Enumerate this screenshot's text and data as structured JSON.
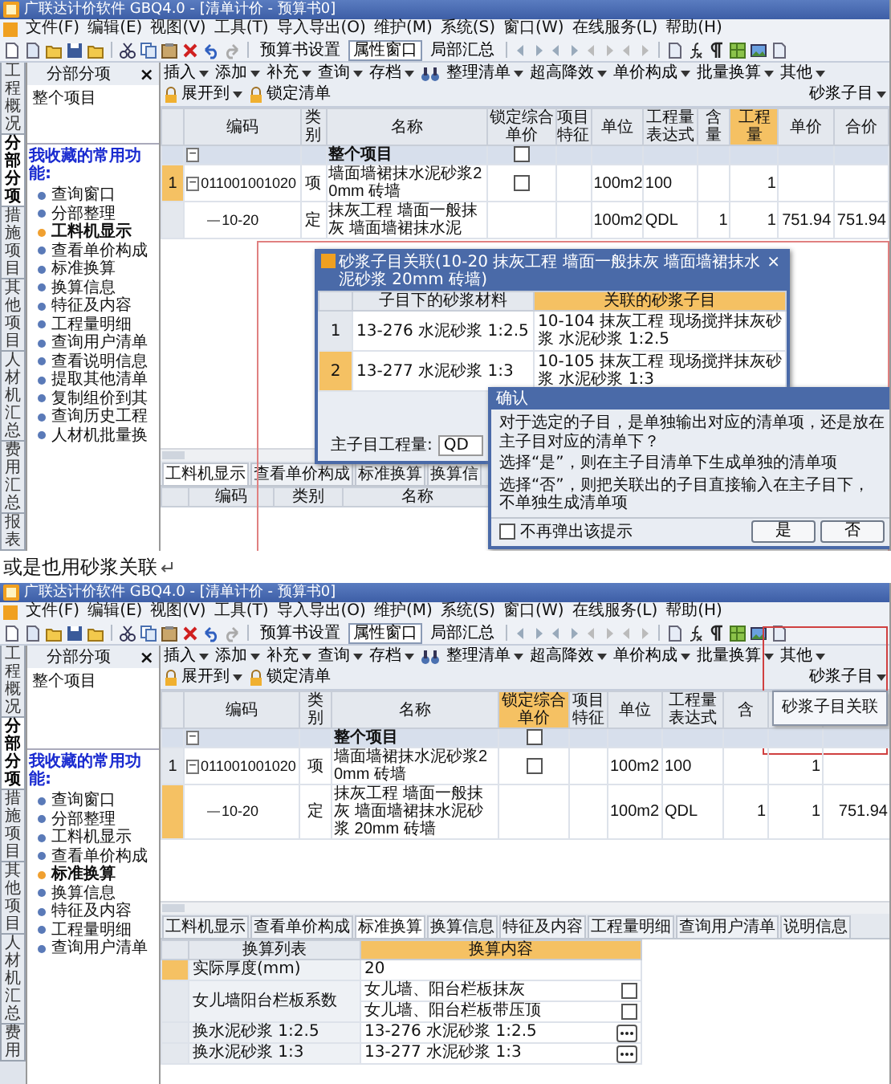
{
  "shot_1": {
    "window": {
      "title": "广联达计价软件 GBQ4.0 - [清单计价 - 预算书0]"
    },
    "menu": [
      "文件(F)",
      "编辑(E)",
      "视图(V)",
      "工具(T)",
      "导入导出(O)",
      "维护(M)",
      "系统(S)",
      "窗口(W)",
      "在线服务(L)",
      "帮助(H)"
    ],
    "toolbar": [
      {
        "label": "预算书设置",
        "pressed": false
      },
      {
        "label": "属性窗口",
        "pressed": true
      },
      {
        "label": "局部汇总",
        "pressed": false
      }
    ],
    "panel_title": "分部分项",
    "panel_close": "×",
    "toolbar2": [
      {
        "label": "插入",
        "dropdown": true
      },
      {
        "label": "添加",
        "dropdown": true
      },
      {
        "label": "补充",
        "dropdown": true
      },
      {
        "label": "查询",
        "dropdown": true
      },
      {
        "label": "存档",
        "dropdown": true
      },
      {
        "kind": "tool"
      },
      {
        "label": "整理清单",
        "dropdown": true
      },
      {
        "label": "超高降效",
        "dropdown": true
      },
      {
        "label": "单价构成",
        "dropdown": true
      },
      {
        "label": "批量换算",
        "dropdown": true
      },
      {
        "label": "其他",
        "dropdown": true
      },
      {
        "label": "展开到",
        "dropdown": true,
        "icon": true
      },
      {
        "label": "锁定清单",
        "dropdown": false,
        "icon": true
      },
      {
        "label": "砂浆子目",
        "dropdown": true
      }
    ],
    "side_tabs": [
      {
        "label": "工程概况",
        "selected": false
      },
      {
        "label": "分部分项",
        "selected": true
      },
      {
        "label": "措施项目",
        "selected": false
      },
      {
        "label": "其他项目",
        "selected": false
      },
      {
        "label": "人材机汇总",
        "selected": false
      },
      {
        "label": "费用汇总",
        "selected": false
      },
      {
        "label": "报表",
        "selected": false
      }
    ],
    "tree": [
      "整个项目"
    ],
    "favorites_title": "我收藏的常用功能:",
    "favorites": [
      {
        "label": "查询窗口",
        "selected": false
      },
      {
        "label": "分部整理",
        "selected": false
      },
      {
        "label": "工料机显示",
        "selected": true
      },
      {
        "label": "查看单价构成",
        "selected": false
      },
      {
        "label": "标准换算",
        "selected": false
      },
      {
        "label": "换算信息",
        "selected": false
      },
      {
        "label": "特征及内容",
        "selected": false
      },
      {
        "label": "工程量明细",
        "selected": false
      },
      {
        "label": "查询用户清单",
        "selected": false
      },
      {
        "label": "查看说明信息",
        "selected": false
      },
      {
        "label": "提取其他清单",
        "selected": false
      },
      {
        "label": "复制组价到其",
        "selected": false
      },
      {
        "label": "查询历史工程",
        "selected": false
      },
      {
        "label": "人材机批量换",
        "selected": false
      }
    ],
    "table": {
      "columns": [
        {
          "label": "编码",
          "selected": false
        },
        {
          "label": "类别",
          "selected": false
        },
        {
          "label": "名称",
          "selected": false
        },
        {
          "label": "锁定综合单价",
          "selected": false
        },
        {
          "label": "项目特征",
          "selected": false
        },
        {
          "label": "单位",
          "selected": false
        },
        {
          "label": "工程量表达式",
          "selected": false
        },
        {
          "label": "含量",
          "selected": false
        },
        {
          "label": "工程量",
          "selected": true
        },
        {
          "label": "单价",
          "selected": false
        },
        {
          "label": "合价",
          "selected": false
        }
      ],
      "rows": [
        {
          "kind": "group",
          "selected": false,
          "toggle": "−",
          "cells": [
            null,
            null,
            "整个项目",
            {
              "kind": "checkbox",
              "checked": false
            },
            null,
            null,
            null,
            null,
            null,
            null,
            null
          ],
          "children": [
            {
              "kind": "item",
              "selected": true,
              "num": "1",
              "toggle": "−",
              "cells": [
                "011001001020",
                "项",
                "墙面墙裙抹水泥砂浆20mm 砖墙",
                {
                  "kind": "checkbox",
                  "checked": false
                },
                null,
                "100m2",
                "100",
                null,
                "1",
                null,
                null
              ],
              "children": [
                {
                  "kind": "item",
                  "selected": false,
                  "cells": [
                    "10-20",
                    "定",
                    "抹灰工程 墙面一般抹灰 墙面墙裙抹水泥",
                    null,
                    null,
                    "100m2",
                    "QDL",
                    "1",
                    "1",
                    "751.94",
                    "751.94"
                  ]
                }
              ]
            }
          ]
        }
      ]
    },
    "bottom_tabs": [
      {
        "label": "工料机显示",
        "selected": true
      },
      {
        "label": "查看单价构成",
        "selected": false
      },
      {
        "label": "标准换算",
        "selected": false
      },
      {
        "label": "换算信",
        "selected": false
      }
    ],
    "bottom_table": {
      "columns": [
        {
          "label": "编码",
          "selected": false
        },
        {
          "label": "类别",
          "selected": false
        },
        {
          "label": "名称",
          "selected": false
        }
      ]
    },
    "dialog": {
      "title": "砂浆子目关联(10-20 抹灰工程 墙面一般抹灰 墙面墙裙抹水泥砂浆 20mm 砖墙)",
      "close": "×",
      "columns": [
        {
          "label": "子目下的砂浆材料",
          "selected": false
        },
        {
          "label": "关联的砂浆子目",
          "selected": true
        }
      ],
      "rows": [
        {
          "num": "1",
          "selected": false,
          "cells": [
            "13-276 水泥砂浆 1:2.5",
            "10-104 抹灰工程 现场搅拌抹灰砂浆 水泥砂浆 1:2.5"
          ]
        },
        {
          "num": "2",
          "selected": true,
          "cells": [
            "13-277 水泥砂浆 1:3",
            "10-105 抹灰工程 现场搅拌抹灰砂浆 水泥砂浆 1:3"
          ]
        }
      ],
      "footer_label": "主子目工程量:",
      "footer_value": "QD"
    },
    "confirm": {
      "title": "确认",
      "paragraphs": [
        "对于选定的子目，是单独输出对应的清单项，还是放在主子目对应的清单下？",
        "选择“是”，则在主子目清单下生成单独的清单项",
        "选择“否”，则把关联出的子目直接输入在主子目下，不单独生成清单项"
      ],
      "checkbox": {
        "label": "不再弹出该提示",
        "checked": false
      },
      "buttons": [
        "是",
        "否"
      ]
    }
  },
  "caption": "或是也用砂浆关联",
  "shot_2": {
    "window": {
      "title": "广联达计价软件 GBQ4.0 - [清单计价 - 预算书0]"
    },
    "menu": [
      "文件(F)",
      "编辑(E)",
      "视图(V)",
      "工具(T)",
      "导入导出(O)",
      "维护(M)",
      "系统(S)",
      "窗口(W)",
      "在线服务(L)",
      "帮助(H)"
    ],
    "toolbar": [
      {
        "label": "预算书设置",
        "pressed": false
      },
      {
        "label": "属性窗口",
        "pressed": true
      },
      {
        "label": "局部汇总",
        "pressed": false
      }
    ],
    "panel_title": "分部分项",
    "panel_close": "×",
    "toolbar2": [
      {
        "label": "插入",
        "dropdown": true
      },
      {
        "label": "添加",
        "dropdown": true
      },
      {
        "label": "补充",
        "dropdown": true
      },
      {
        "label": "查询",
        "dropdown": true
      },
      {
        "label": "存档",
        "dropdown": true
      },
      {
        "kind": "tool"
      },
      {
        "label": "整理清单",
        "dropdown": true
      },
      {
        "label": "超高降效",
        "dropdown": true
      },
      {
        "label": "单价构成",
        "dropdown": true
      },
      {
        "label": "批量换算",
        "dropdown": true
      },
      {
        "label": "其他",
        "dropdown": true
      },
      {
        "label": "展开到",
        "dropdown": true,
        "icon": true
      },
      {
        "label": "锁定清单",
        "dropdown": false,
        "icon": true
      },
      {
        "label": "砂浆子目",
        "dropdown": true
      }
    ],
    "side_tabs": [
      {
        "label": "工程概况",
        "selected": false
      },
      {
        "label": "分部分项",
        "selected": true
      },
      {
        "label": "措施项目",
        "selected": false
      },
      {
        "label": "其他项目",
        "selected": false
      },
      {
        "label": "人材机汇总",
        "selected": false
      },
      {
        "label": "费用",
        "selected": false
      }
    ],
    "tree": [
      "整个项目"
    ],
    "favorites_title": "我收藏的常用功能:",
    "favorites": [
      {
        "label": "查询窗口",
        "selected": false
      },
      {
        "label": "分部整理",
        "selected": false
      },
      {
        "label": "工料机显示",
        "selected": false
      },
      {
        "label": "查看单价构成",
        "selected": false
      },
      {
        "label": "标准换算",
        "selected": true
      },
      {
        "label": "换算信息",
        "selected": false
      },
      {
        "label": "特征及内容",
        "selected": false
      },
      {
        "label": "工程量明细",
        "selected": false
      },
      {
        "label": "查询用户清单",
        "selected": false
      }
    ],
    "table": {
      "columns": [
        {
          "label": "编码",
          "selected": false
        },
        {
          "label": "类别",
          "selected": false
        },
        {
          "label": "名称",
          "selected": false
        },
        {
          "label": "锁定综合单价",
          "selected": true
        },
        {
          "label": "项目特征",
          "selected": false
        },
        {
          "label": "单位",
          "selected": false
        },
        {
          "label": "工程量表达式",
          "selected": false
        },
        {
          "label": "含",
          "selected": false
        },
        {
          "selected": false
        },
        {
          "selected": false
        }
      ],
      "rows": [
        {
          "kind": "group",
          "selected": false,
          "toggle": "−",
          "cells": [
            null,
            null,
            "整个项目",
            {
              "kind": "checkbox",
              "checked": false
            },
            null,
            null,
            null,
            null,
            null,
            null
          ],
          "children": [
            {
              "kind": "item",
              "selected": false,
              "num": "1",
              "toggle": "−",
              "cells": [
                "011001001020",
                "项",
                "墙面墙裙抹水泥砂浆20mm 砖墙",
                {
                  "kind": "checkbox",
                  "checked": false
                },
                null,
                "100m2",
                "100",
                null,
                "1",
                null
              ],
              "children": [
                {
                  "kind": "item",
                  "selected": true,
                  "cells": [
                    "10-20",
                    "定",
                    "抹灰工程 墙面一般抹灰 墙面墙裙抹水泥砂浆 20mm 砖墙",
                    null,
                    null,
                    "100m2",
                    "QDL",
                    "1",
                    "1",
                    "751.94"
                  ]
                }
              ]
            }
          ]
        }
      ]
    },
    "dropdown_menu": {
      "items": [
        "砂浆子目关联"
      ]
    },
    "bottom_tabs": [
      {
        "label": "工料机显示",
        "selected": false
      },
      {
        "label": "查看单价构成",
        "selected": false
      },
      {
        "label": "标准换算",
        "selected": true
      },
      {
        "label": "换算信息",
        "selected": false
      },
      {
        "label": "特征及内容",
        "selected": false
      },
      {
        "label": "工程量明细",
        "selected": false
      },
      {
        "label": "查询用户清单",
        "selected": false
      },
      {
        "label": "说明信息",
        "selected": false
      }
    ],
    "bottom_table": {
      "columns": [
        {
          "label": "换算列表",
          "selected": false
        },
        {
          "label": "换算内容",
          "selected": true
        }
      ],
      "rows": [
        {
          "kind": "value",
          "selected": true,
          "label": "实际厚度(mm)",
          "value": "20"
        },
        {
          "kind": "options",
          "selected": false,
          "label": "女儿墙阳台栏板系数",
          "options": [
            {
              "label": "女儿墙、阳台栏板抹灰",
              "checked": false
            },
            {
              "label": "女儿墙、阳台栏板带压顶",
              "checked": false
            }
          ]
        },
        {
          "kind": "picker",
          "selected": false,
          "label": "换水泥砂浆 1:2.5",
          "value": "13-276  水泥砂浆 1:2.5"
        },
        {
          "kind": "picker",
          "selected": false,
          "label": "换水泥砂浆 1:3",
          "value": "13-277  水泥砂浆 1:3"
        }
      ]
    }
  }
}
